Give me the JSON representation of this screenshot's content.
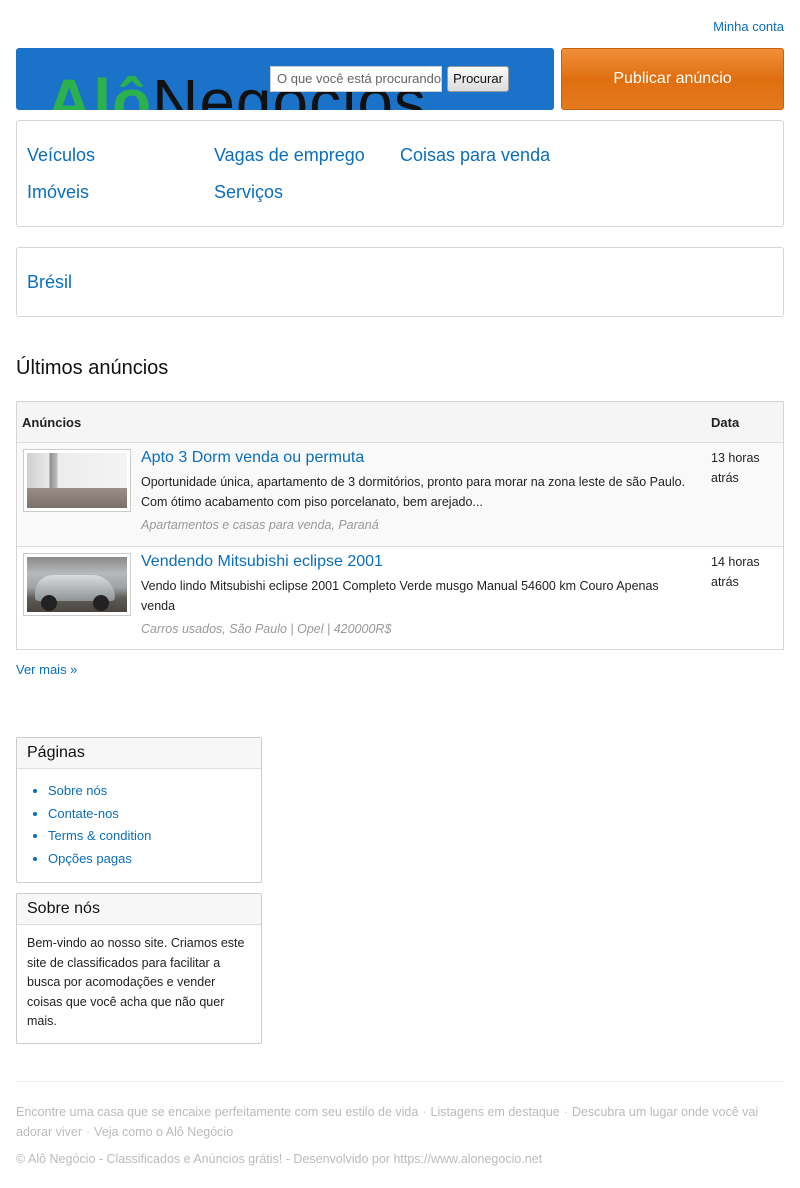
{
  "header": {
    "account_link": "Minha conta",
    "logo_text_green": "Alô",
    "logo_text_dark": "Negócios",
    "search": {
      "placeholder": "O que você está procurando?",
      "button_label": "Procurar"
    },
    "publish_label": "Publicar anúncio"
  },
  "categories": [
    "Veículos",
    "Vagas de emprego",
    "Coisas para venda",
    "Imóveis",
    "Serviços"
  ],
  "region": "Brésil",
  "latest": {
    "title": "Últimos anúncios",
    "col_ads": "Anúncios",
    "col_date": "Data",
    "ads": [
      {
        "title": "Apto 3 Dorm venda ou permuta",
        "description": "Oportunidade única, apartamento de 3 dormitórios, pronto para morar na zona leste de são Paulo. Com ótimo acabamento com piso porcelanato, bem arejado...",
        "meta": "Apartamentos e casas para venda, Paraná",
        "date": "13 horas atrás"
      },
      {
        "title": "Vendendo Mitsubishi eclipse 2001",
        "description": "Vendo lindo Mitsubishi eclipse 2001 Completo Verde musgo Manual 54600 km Couro Apenas venda",
        "meta": "Carros usados, São Paulo | Opel | 420000R$",
        "date": "14 horas atrás"
      }
    ],
    "more_link": "Ver mais »"
  },
  "sidebar": {
    "pages_title": "Páginas",
    "pages": [
      "Sobre nós",
      "Contate-nos",
      "Terms & condition",
      "Opções pagas"
    ],
    "about_title": "Sobre nós",
    "about_text": "Bem-vindo ao nosso site. Criamos este site de classificados para facilitar a busca por acomodações e vender coisas que você acha que não quer mais."
  },
  "footer": {
    "links": [
      "Encontre uma casa que se encaixe perfeitamente com seu estilo de vida",
      "Listagens em destaque",
      "Descubra um lugar onde você vai adorar viver",
      "Veja como o Alô Negócio"
    ],
    "separator": "·",
    "copyright": "© Alô Negócio - Classificados e Anúncios grátis! - Desenvolvido por https://www.alonegocio.net"
  },
  "colors": {
    "link": "#0a6ebd",
    "banner": "#1a73c8",
    "publish": "#e57a1e",
    "logo_green": "#2bb24c"
  }
}
